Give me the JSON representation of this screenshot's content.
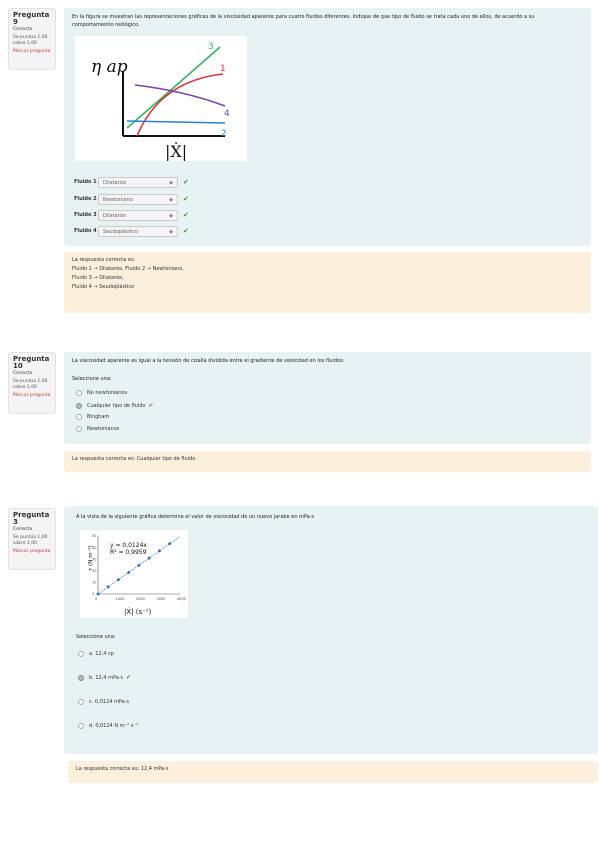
{
  "q9": {
    "info": {
      "prefix": "Pregunta",
      "number": "9",
      "state": "Correcta",
      "grade": "Se puntúa 1,00 sobre 1,00",
      "flag": "Marcar pregunta"
    },
    "text": "En la figura se muestran las representaciones gráficas de la viscosidad aparente para cuatro fluidos diferentes. Indique de que tipo de fluido se trata cada uno de ellos, de acuerdo a su comportamiento reológico.",
    "figure": {
      "ylabel": "η ap",
      "xlabel": "|Ẋ|",
      "curves": [
        "1",
        "2",
        "3",
        "4"
      ]
    },
    "rows": [
      {
        "label": "Fluido 1",
        "value": "Dilatante"
      },
      {
        "label": "Fluido 2",
        "value": "Newtoniano"
      },
      {
        "label": "Fluido 3",
        "value": "Dilatante"
      },
      {
        "label": "Fluido 4",
        "value": "Seudoplástico"
      }
    ],
    "feedback": [
      "La respuesta correcta es:",
      "Fluido 1 → Dilatante, Fluido 2 → Newtoniano,",
      "Fluido 3 → Dilatante,",
      "Fluido 4 → Seudoplástico"
    ]
  },
  "q10": {
    "info": {
      "prefix": "Pregunta",
      "number": "10",
      "state": "Correcta",
      "grade": "Se puntúa 1,00 sobre 1,00",
      "flag": "Marcar pregunta"
    },
    "text": "La viscosidad aparente es igual a la tensión de cizalla dividida entre el gradiente de velocidad en los fluidos:",
    "prompt": "Seleccione una:",
    "options": [
      "No newtonianos",
      "Cualquier tipo de fluido",
      "Bingham",
      "Newtonianos"
    ],
    "selected": 1,
    "feedback": "La respuesta correcta es: Cualquier tipo de fluido"
  },
  "q3": {
    "info": {
      "prefix": "Pregunta",
      "number": "3",
      "state": "Correcta",
      "grade": "Se puntúa 1,00 sobre 1,00",
      "flag": "Marcar pregunta"
    },
    "text": "A la vista de la siguiente gráfica determine el valor de viscosidad de un nuevo jarabe en mPa·s",
    "chart": {
      "equation": "y = 0,0124x",
      "r2": "R² = 0,9959",
      "ylabel": "τ (N m⁻²)",
      "xlabel": "|Ẋ| (s⁻¹)",
      "xticks": [
        "0",
        "1000",
        "2000",
        "3000",
        "4000"
      ],
      "yticks": [
        "0",
        "10",
        "20",
        "30",
        "40",
        "50"
      ]
    },
    "chart_data": {
      "type": "scatter",
      "x": [
        0,
        500,
        1000,
        1500,
        2000,
        2500,
        3000,
        3500
      ],
      "y": [
        0,
        6.2,
        12.4,
        18.6,
        24.8,
        31.0,
        37.2,
        43.4
      ],
      "xlim": [
        0,
        4000
      ],
      "ylim": [
        0,
        50
      ],
      "trendline": {
        "slope": 0.0124,
        "intercept": 0
      }
    },
    "prompt": "Seleccione una:",
    "options": [
      "a. 12,4 cp",
      "b. 12,4 mPa·s",
      "c. 0,0124 mPa·s",
      "d. 0,0124 N m⁻² s⁻¹"
    ],
    "selected": 1,
    "feedback": "La respuesta correcta es: 12,4 mPa·s"
  },
  "colors": {
    "curve1": "#e0303a",
    "curve2": "#2a7fd0",
    "curve3": "#2eb85c",
    "curve4": "#7a3fb0"
  }
}
